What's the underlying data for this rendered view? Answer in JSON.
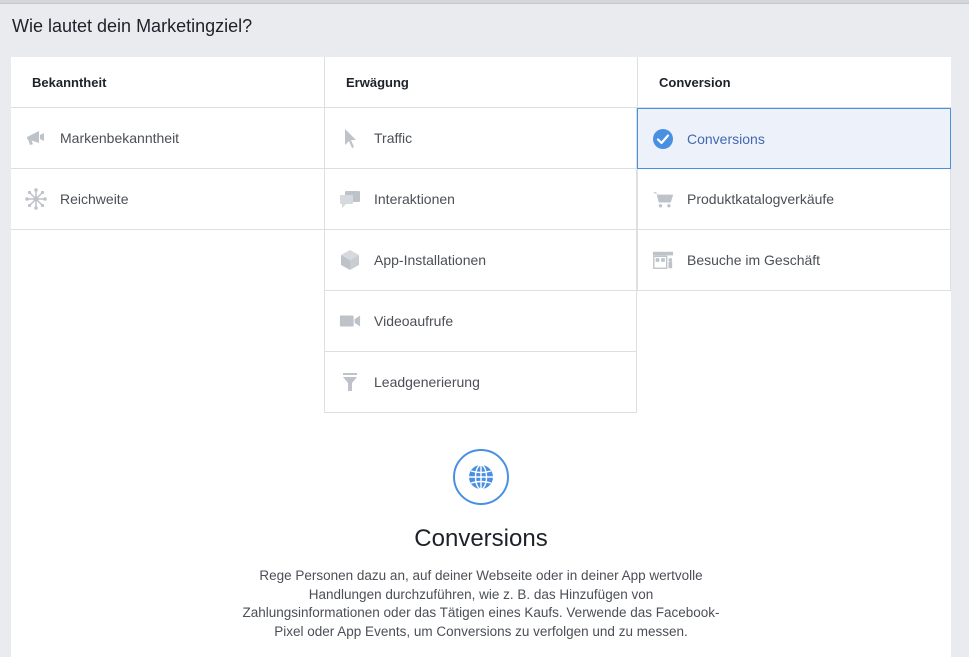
{
  "page_title": "Wie lautet dein Marketingziel?",
  "columns": [
    {
      "header": "Bekanntheit",
      "items": [
        {
          "label": "Markenbekanntheit",
          "icon": "megaphone-icon"
        },
        {
          "label": "Reichweite",
          "icon": "reach-icon"
        }
      ]
    },
    {
      "header": "Erwägung",
      "items": [
        {
          "label": "Traffic",
          "icon": "cursor-icon"
        },
        {
          "label": "Interaktionen",
          "icon": "chat-bubbles-icon"
        },
        {
          "label": "App-Installationen",
          "icon": "box-icon"
        },
        {
          "label": "Videoaufrufe",
          "icon": "video-camera-icon"
        },
        {
          "label": "Leadgenerierung",
          "icon": "funnel-icon"
        }
      ]
    },
    {
      "header": "Conversion",
      "items": [
        {
          "label": "Conversions",
          "icon": "checkmark-circle-icon",
          "selected": true
        },
        {
          "label": "Produktkatalogverkäufe",
          "icon": "shopping-cart-icon"
        },
        {
          "label": "Besuche im Geschäft",
          "icon": "store-icon"
        }
      ]
    }
  ],
  "detail": {
    "icon": "globe-icon",
    "title": "Conversions",
    "description": "Rege Personen dazu an, auf deiner Webseite oder in deiner App wertvolle Handlungen durchzuführen, wie z. B. das Hinzufügen von Zahlungsinformationen oder das Tätigen eines Kaufs. Verwende das Facebook-Pixel oder App Events, um Conversions zu verfolgen und zu messen."
  },
  "colors": {
    "accent": "#4a90e2",
    "selected_bg": "#edf2fa",
    "icon_gray": "#bec3c9",
    "background": "#e9ebee"
  }
}
